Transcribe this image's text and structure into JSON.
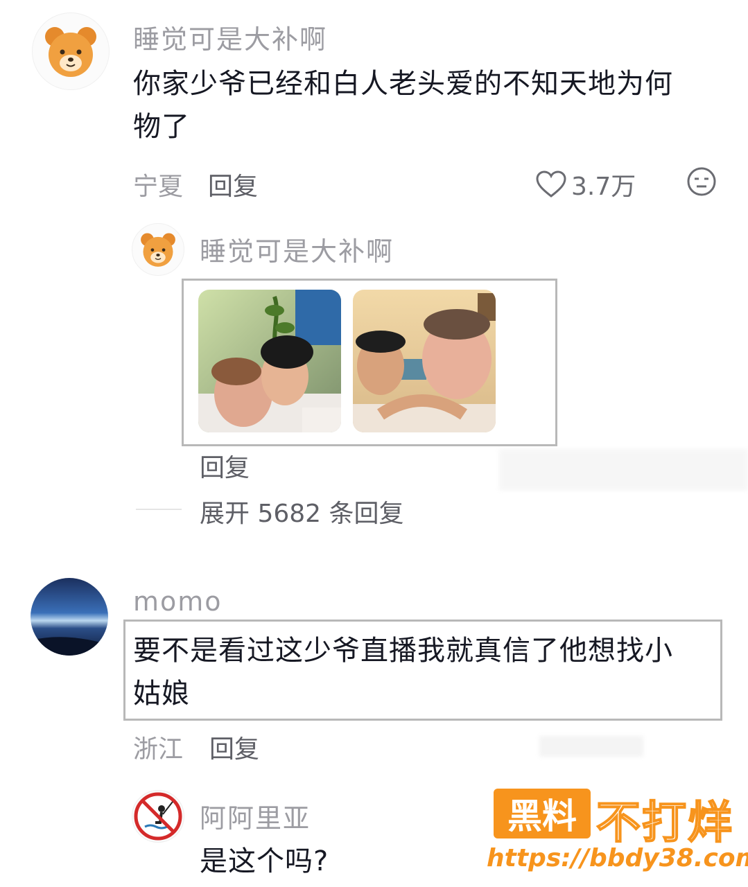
{
  "comments": [
    {
      "username": "睡觉可是大补啊",
      "text_line1": "你家少爷已经和白人老头爱的不知天地为何",
      "text_line2": "物了",
      "location": "宁夏",
      "reply_label": "回复",
      "likes": "3.7万",
      "avatar_icon": "bear-avatar-icon"
    },
    {
      "username": "睡觉可是大补啊",
      "reply_label": "回复",
      "avatar_icon": "bear-avatar-icon"
    },
    {
      "username": "momo",
      "text_line1": "要不是看过这少爷直播我就真信了他想找小",
      "text_line2": "姑娘",
      "location": "浙江",
      "reply_label": "回复",
      "avatar_icon": "horizon-avatar-icon"
    },
    {
      "username": "阿阿里亚",
      "text_line1": "是这个吗?",
      "avatar_icon": "no-fishing-avatar-icon"
    }
  ],
  "expand_replies": "展开 5682 条回复",
  "watermark": {
    "badge": "黑料",
    "slogan": "不打烊",
    "url": "https://bbdy38.com"
  },
  "colors": {
    "accent_orange": "#f7941d",
    "username_gray": "#9c9ca2",
    "frame_gray": "#b8b8b8"
  }
}
